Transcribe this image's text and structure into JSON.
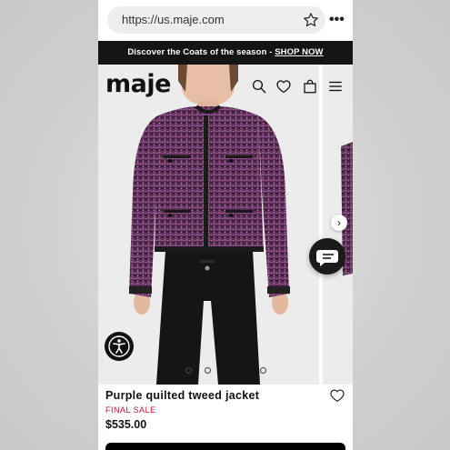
{
  "browser": {
    "url": "https://us.maje.com",
    "bookmark_icon": "star-icon",
    "menu_icon": "more-icon",
    "menu_glyph": "•••"
  },
  "promo": {
    "text": "Discover the Coats of the season - ",
    "link": "SHOP NOW"
  },
  "header": {
    "logo": "maje",
    "icons": [
      "search-icon",
      "heart-icon",
      "bag-icon",
      "hamburger-icon"
    ]
  },
  "gallery": {
    "next_arrow": "›",
    "image_count": 5,
    "active_index": 0
  },
  "product": {
    "name": "Purple quilted tweed jacket",
    "sale_label": "FINAL SALE",
    "price": "$535.00"
  },
  "colors": {
    "promo_bg": "#141414",
    "sale_red": "#c8102e",
    "tweed_purple": "#6b3a66"
  }
}
